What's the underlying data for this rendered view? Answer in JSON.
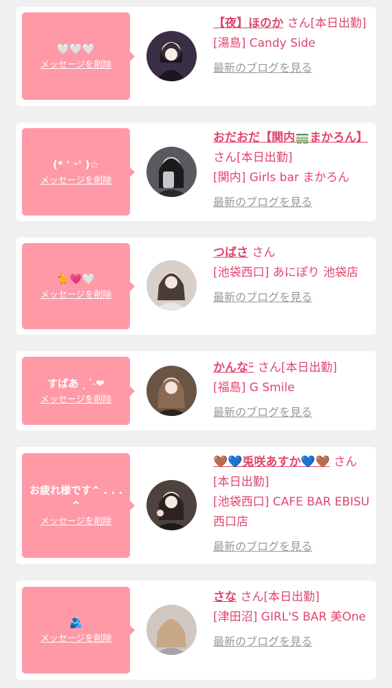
{
  "delete_label": "メッセージを削除",
  "blog_label": "最新のブログを見る",
  "honorific": "さん",
  "colors": {
    "accent": "#e0456b",
    "bubble": "#ff99a7",
    "muted": "#999999",
    "background": "#f0f0f0"
  },
  "cards": [
    {
      "message": "🤍🤍🤍",
      "name": "【夜】ほのか",
      "status": "[本日出勤]",
      "shop": "[湯島] Candy Side",
      "avatar": "avatar-photo"
    },
    {
      "message": "(* ' ᵕ' )☆",
      "name": "おだおだ【関内🚃まかろん】",
      "status": "[本日出勤]",
      "shop": "[関内] Girls bar まかろん",
      "avatar": "avatar-photo"
    },
    {
      "message": "🐈💗🤍",
      "name": "つばさ",
      "status": "",
      "shop": "[池袋西口] あにぽり 池袋店",
      "avatar": "avatar-photo"
    },
    {
      "message": "すぱあ ˎˊ˗❤︎",
      "name": "かんなᵕ̈",
      "status": "[本日出勤]",
      "shop": "[福島] G Smile",
      "avatar": "avatar-photo"
    },
    {
      "message": "お疲れ様です^ . . .^",
      "name": "🤎💙兎咲あすか💙🤎",
      "status": "[本日出勤]",
      "shop": "[池袋西口] CAFE BAR EBISU 西口店",
      "avatar": "avatar-photo"
    },
    {
      "message": "🫂",
      "name": "さな",
      "status": "[本日出勤]",
      "shop": "[津田沼] GIRL'S BAR 美One",
      "avatar": "avatar-photo"
    }
  ]
}
